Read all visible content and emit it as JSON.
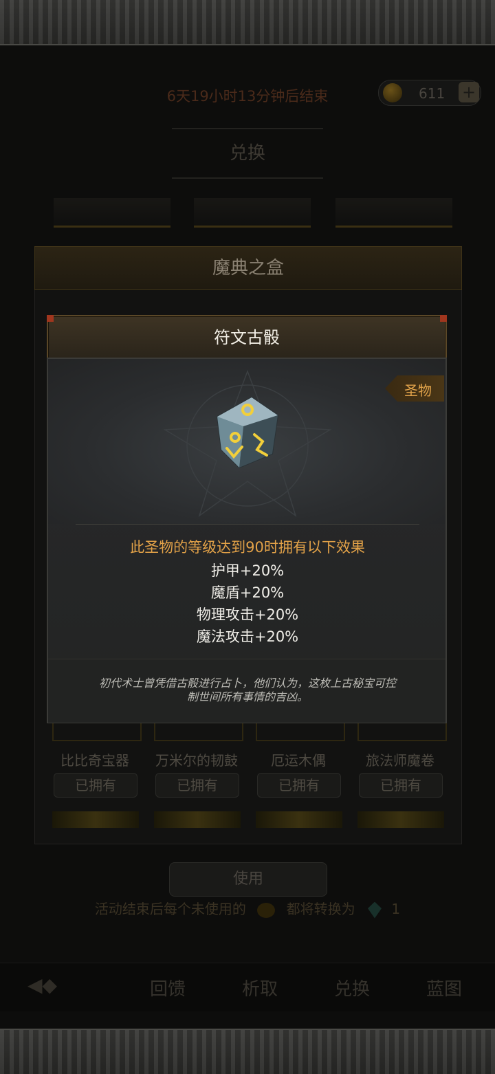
{
  "header": {
    "timer_text": "6天19小时13分钟后结束",
    "currency_value": "611",
    "currency_plus": "+",
    "section_title": "兑换"
  },
  "box_panel": {
    "title": "魔典之盒",
    "items": [
      {
        "name": "比比奇宝器",
        "status": "已拥有"
      },
      {
        "name": "万米尔的韧鼓",
        "status": "已拥有"
      },
      {
        "name": "厄运木偶",
        "status": "已拥有"
      },
      {
        "name": "旅法师魔卷",
        "status": "已拥有"
      }
    ]
  },
  "use_button": "使用",
  "conversion_note": {
    "prefix": "活动结束后每个未使用的",
    "middle": "都将转换为",
    "amount": "1"
  },
  "tabs": [
    "回馈",
    "析取",
    "兑换",
    "蓝图"
  ],
  "modal": {
    "title": "符文古骰",
    "tag": "圣物",
    "effect_title": "此圣物的等级达到90时拥有以下效果",
    "effects": [
      "护甲+20%",
      "魔盾+20%",
      "物理攻击+20%",
      "魔法攻击+20%"
    ],
    "flavor_text_line1": "初代术士曾凭借古骰进行占卜，他们认为，这枚上古秘宝可控",
    "flavor_text_line2": "制世间所有事情的吉凶。"
  },
  "colors": {
    "accent_gold": "#e3a248",
    "modal_bg": "#2b2d2e",
    "dim_overlay": "#0d0d0c"
  },
  "icons": [
    "coin-icon",
    "plus-icon",
    "back-arrow-icon",
    "rune-dice-icon",
    "gem-icon"
  ]
}
